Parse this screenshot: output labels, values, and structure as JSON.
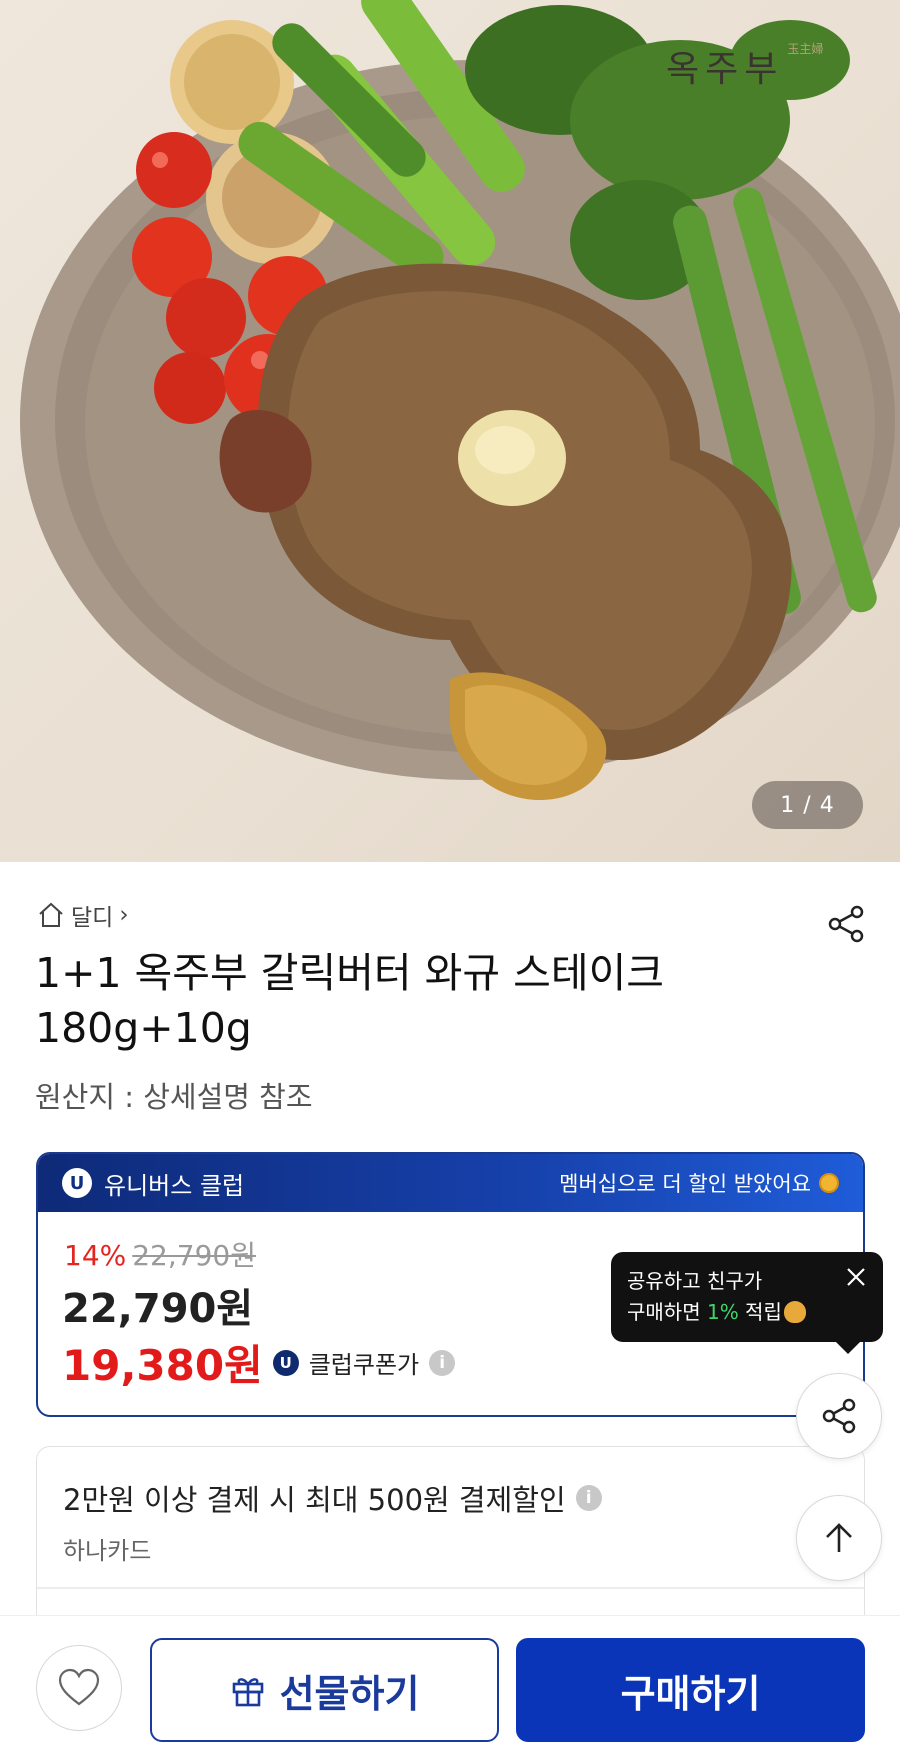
{
  "hero": {
    "brand_mark": "옥주부",
    "brand_mark_small": "玉主婦",
    "image_counter": "1 / 4"
  },
  "product": {
    "breadcrumb_store": "달디",
    "breadcrumb_chevron": "›",
    "title": "1+1 옥주부 갈릭버터 와규 스테이크 180g+10g",
    "origin": "원산지 : 상세설명 참조"
  },
  "club": {
    "badge": "U",
    "name": "유니버스 클럽",
    "promo": "멤버십으로 더 할인 받았어요"
  },
  "price": {
    "discount_pct": "14%",
    "original_price": "22,790원",
    "sale_price": "22,790원",
    "coupon_price": "19,380원",
    "coupon_badge": "U",
    "coupon_label": "클럽쿠폰가",
    "info_glyph": "i"
  },
  "tooltip": {
    "line1": "공유하고 친구가",
    "line2_prefix": "구매하면 ",
    "line2_pct": "1%",
    "line2_suffix": " 적립"
  },
  "card_offer": {
    "title": "2만원 이상 결제 시 최대 500원 결제할인",
    "card_name": "하나카드",
    "info_glyph": "i"
  },
  "bottom_bar": {
    "gift_label": "선물하기",
    "buy_label": "구매하기"
  },
  "colors": {
    "primary_blue": "#0b35b8",
    "club_navy": "#10307f",
    "sale_red": "#e21a1a",
    "discount_red": "#e32520",
    "tooltip_green": "#3ed66a"
  }
}
